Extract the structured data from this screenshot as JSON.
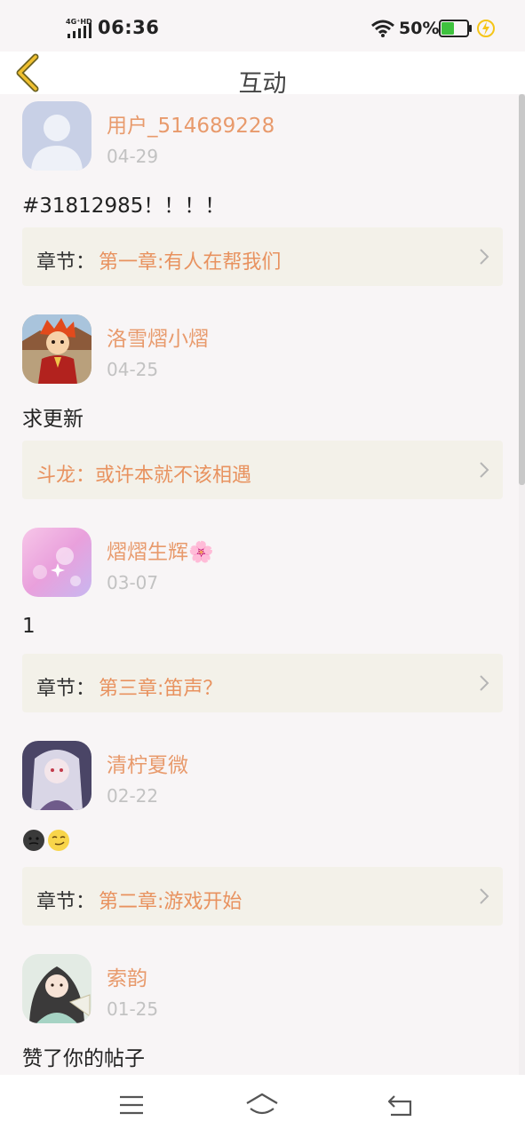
{
  "status_bar": {
    "network": "4G+HD",
    "time": "06:36",
    "battery_percent": "50%",
    "battery_level": 0.5,
    "battery_color": "#3ec23e"
  },
  "header": {
    "title": "互动",
    "back_icon": "chevron-left-icon",
    "accent": "#e8b020"
  },
  "colors": {
    "username": "#e89a6c",
    "link_title": "#e8925f",
    "link_bg": "#f3f1e9",
    "date": "#c2c2c2"
  },
  "items": [
    {
      "username": "用户_514689228",
      "date": "04-29",
      "text": "#31812985！！！！",
      "link_prefix": "章节：",
      "link_title": "第一章:有人在帮我们",
      "avatar": "default-avatar"
    },
    {
      "username": "洛雪熠小熠",
      "date": "04-25",
      "text": "求更新",
      "link_prefix": "",
      "link_title": "斗龙：或许本就不该相遇",
      "avatar": "cartoon-boy-avatar"
    },
    {
      "username": "熠熠生辉🌸",
      "date": "03-07",
      "text": "1",
      "link_prefix": "章节：",
      "link_title": "第三章:笛声？",
      "avatar": "pink-sparkle-avatar"
    },
    {
      "username": "清柠夏微",
      "date": "02-22",
      "text": "",
      "emojis": [
        "dark-face-emoji",
        "smirk-face-emoji"
      ],
      "link_prefix": "章节：",
      "link_title": "第二章:游戏开始",
      "avatar": "anime-girl-avatar"
    },
    {
      "username": "索韵",
      "date": "01-25",
      "text": "赞了你的帖子",
      "avatar": "ancient-girl-avatar"
    }
  ],
  "system_nav": {
    "menu_icon": "menu-icon",
    "home_icon": "home-icon",
    "back_icon": "back-icon"
  }
}
